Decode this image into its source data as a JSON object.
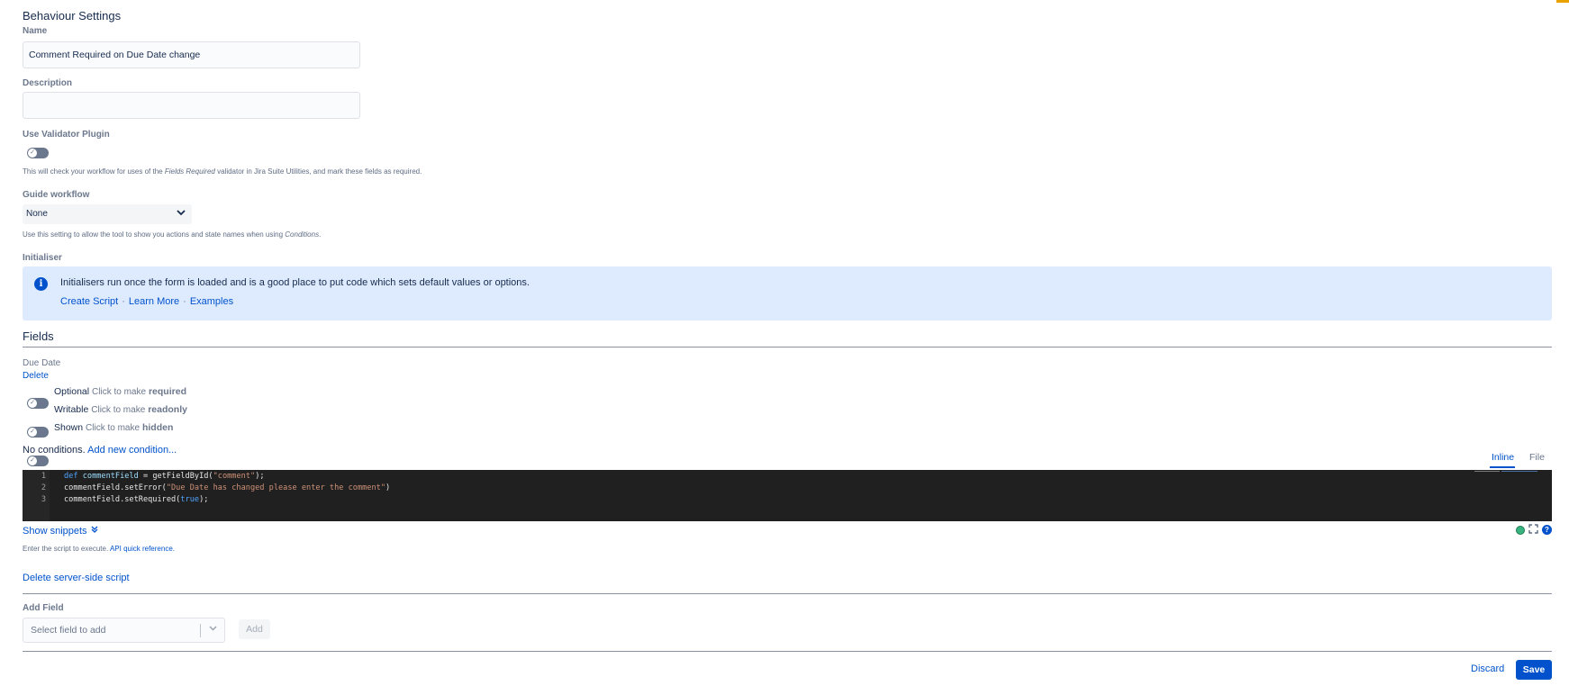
{
  "page": {
    "title": "Behaviour Settings"
  },
  "name_field": {
    "label": "Name",
    "value": "Comment Required on Due Date change"
  },
  "description_field": {
    "label": "Description",
    "value": ""
  },
  "validator": {
    "label": "Use Validator Plugin",
    "help_prefix": "This will check your workflow for uses of the ",
    "help_em": "Fields Required",
    "help_suffix": " validator in Jira Suite Utilities, and mark these fields as required."
  },
  "guide_workflow": {
    "label": "Guide workflow",
    "selected": "None",
    "help_prefix": "Use this setting to allow the tool to show you actions and state names when using ",
    "help_em": "Conditions",
    "help_suffix": "."
  },
  "initialiser": {
    "label": "Initialiser",
    "message": "Initialisers run once the form is loaded and is a good place to put code which sets default values or options.",
    "links": {
      "create": "Create Script",
      "learn": "Learn More",
      "examples": "Examples",
      "separator": "·"
    }
  },
  "fields_section": {
    "title": "Fields",
    "field_name": "Due Date",
    "delete_label": "Delete",
    "toggles": [
      {
        "state": "Optional",
        "hint": "Click to make",
        "target": "required"
      },
      {
        "state": "Writable",
        "hint": "Click to make",
        "target": "readonly"
      },
      {
        "state": "Shown",
        "hint": "Click to make",
        "target": "hidden"
      }
    ],
    "conditions_text": "No conditions.",
    "add_condition": "Add new condition..."
  },
  "editor": {
    "tabs": {
      "inline": "Inline",
      "file": "File"
    },
    "lines": [
      {
        "n": "1",
        "kw": "def",
        "var": "commentField",
        "rest1": " = getFieldById(",
        "str": "\"comment\"",
        "rest2": ");"
      },
      {
        "n": "2",
        "code": "commentField.setError(",
        "str": "\"Due Date has changed please enter the comment\"",
        "rest": ")"
      },
      {
        "n": "3",
        "code": "commentField.setRequired(",
        "kw": "true",
        "rest": ");"
      }
    ],
    "show_snippets": "Show snippets",
    "help_prefix": "Enter the script to execute. ",
    "api_link": "API quick reference.",
    "delete_script": "Delete server-side script",
    "status_color": "#36b37e"
  },
  "add_field": {
    "label": "Add Field",
    "placeholder": "Select field to add",
    "button": "Add"
  },
  "footer": {
    "discard": "Discard",
    "save": "Save"
  },
  "colors": {
    "accent": "#0052cc",
    "info_bg": "#deebff",
    "editor_bg": "#202020"
  }
}
